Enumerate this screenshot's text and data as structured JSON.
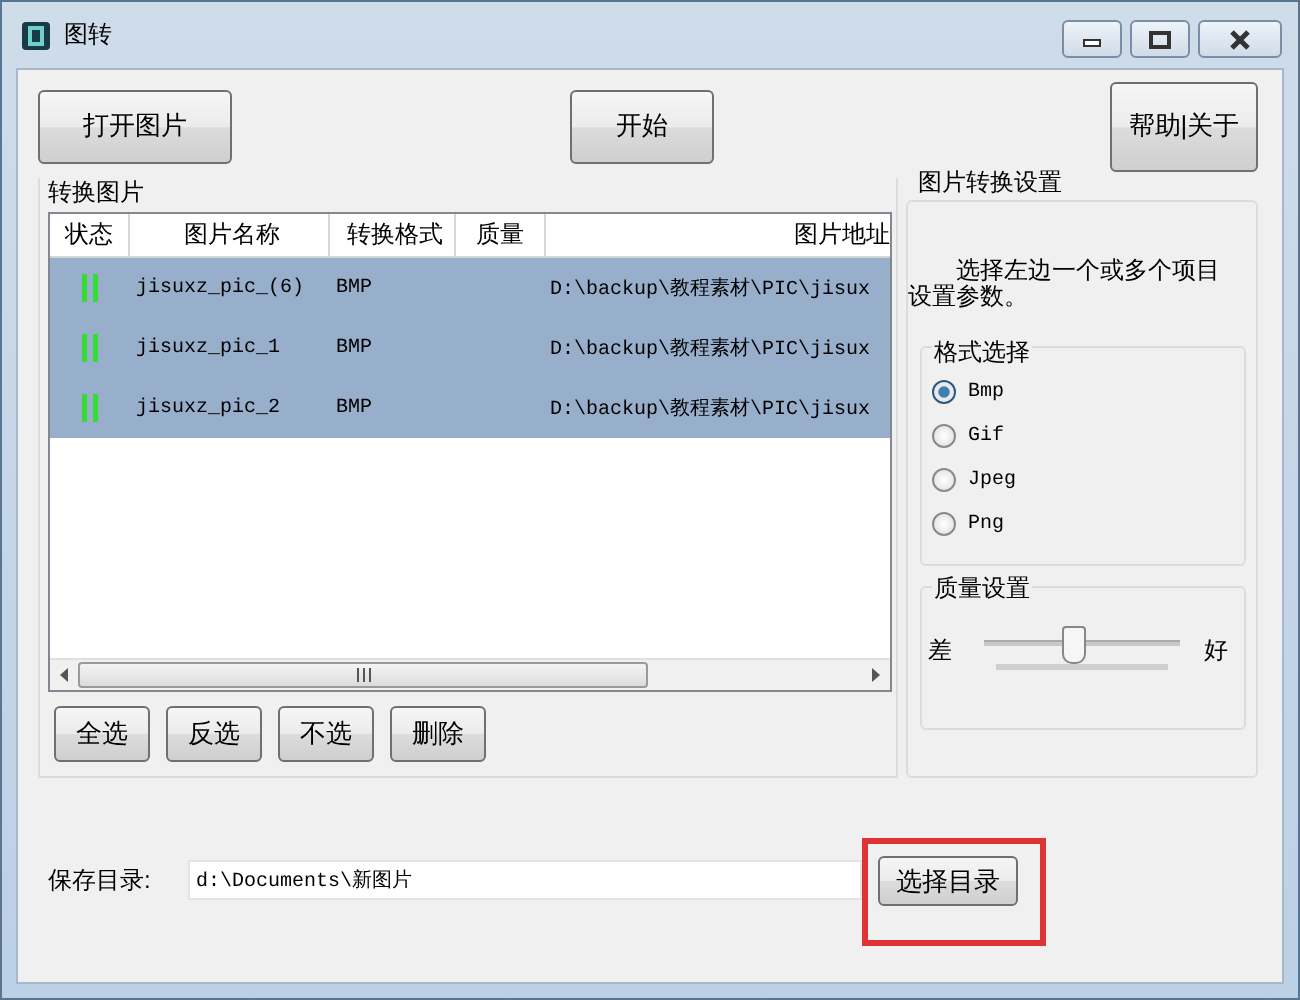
{
  "window": {
    "title": "图转"
  },
  "toolbar": {
    "buttons": [
      {
        "label": "打开图片"
      },
      {
        "label": "开始"
      },
      {
        "label": "帮助|关于"
      }
    ]
  },
  "conversion_list": {
    "title": "转换图片",
    "columns": [
      "状态",
      "图片名称",
      "转换格式",
      "质量",
      "图片地址"
    ],
    "rows": [
      {
        "selected": true,
        "name": "jisuxz_pic_(6)",
        "format": "BMP",
        "quality": "",
        "path": "D:\\backup\\教程素材\\PIC\\jisux"
      },
      {
        "selected": true,
        "name": "jisuxz_pic_1",
        "format": "BMP",
        "quality": "",
        "path": "D:\\backup\\教程素材\\PIC\\jisux"
      },
      {
        "selected": true,
        "name": "jisuxz_pic_2",
        "format": "BMP",
        "quality": "",
        "path": "D:\\backup\\教程素材\\PIC\\jisux"
      }
    ],
    "buttons": [
      "全选",
      "反选",
      "不选",
      "删除"
    ]
  },
  "settings": {
    "title": "图片转换设置",
    "hint": "选择左边一个或多个项目设置参数。",
    "format_group": {
      "title": "格式选择",
      "options": [
        {
          "label": "Bmp",
          "selected": true
        },
        {
          "label": "Gif",
          "selected": false
        },
        {
          "label": "Jpeg",
          "selected": false
        },
        {
          "label": "Png",
          "selected": false
        }
      ]
    },
    "quality_group": {
      "title": "质量设置",
      "low_label": "差",
      "high_label": "好",
      "level": 0.45
    }
  },
  "save": {
    "label": "保存目录:",
    "value": "d:\\Documents\\新图片",
    "button": "选择目录",
    "highlighted": true
  }
}
